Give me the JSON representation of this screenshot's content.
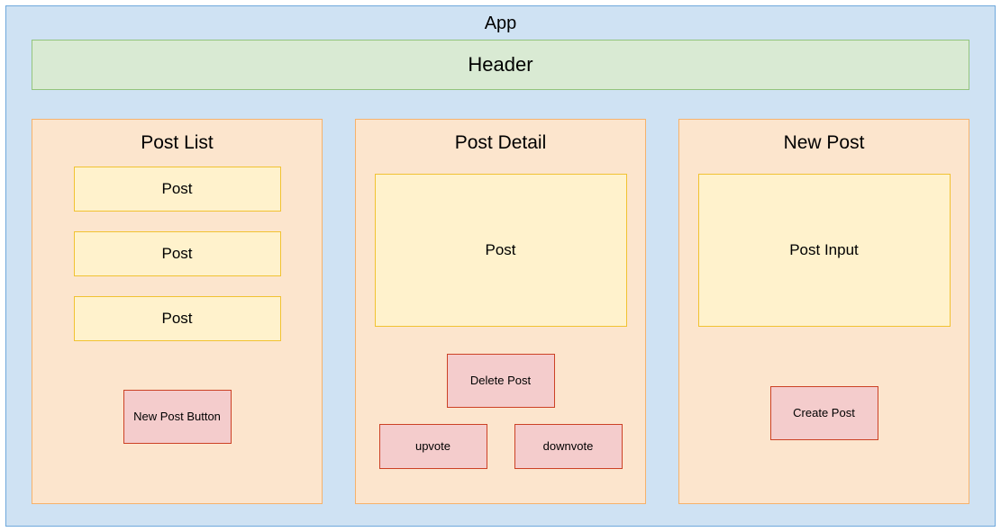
{
  "app": {
    "title": "App"
  },
  "header": {
    "label": "Header"
  },
  "post_list": {
    "title": "Post List",
    "items": [
      {
        "label": "Post"
      },
      {
        "label": "Post"
      },
      {
        "label": "Post"
      }
    ],
    "new_post_button": "New Post Button"
  },
  "post_detail": {
    "title": "Post Detail",
    "post_label": "Post",
    "delete_button": "Delete Post",
    "upvote_button": "upvote",
    "downvote_button": "downvote"
  },
  "new_post": {
    "title": "New Post",
    "input_label": "Post Input",
    "create_button": "Create Post"
  }
}
